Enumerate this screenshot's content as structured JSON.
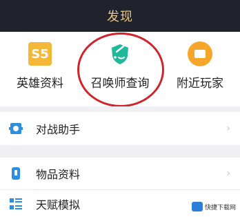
{
  "header": {
    "title": "发现"
  },
  "shortcuts": [
    {
      "label": "英雄资料",
      "icon": "s5-hero-icon",
      "badge_text": "S5"
    },
    {
      "label": "召唤师查询",
      "icon": "shield-search-icon"
    },
    {
      "label": "附近玩家",
      "icon": "nearby-player-icon"
    }
  ],
  "menu": [
    {
      "label": "对战助手",
      "icon": "battle-assistant-icon"
    },
    {
      "label": "物品资料",
      "icon": "item-data-icon"
    },
    {
      "label": "天赋模拟",
      "icon": "talent-sim-icon"
    }
  ],
  "watermark": {
    "text": "快捷下载网"
  },
  "colors": {
    "header_bg": "#20232b",
    "header_text": "#e6c88a",
    "accent_teal": "#1fb89a",
    "accent_orange": "#f6a62b",
    "highlight_red": "#d0242a"
  }
}
